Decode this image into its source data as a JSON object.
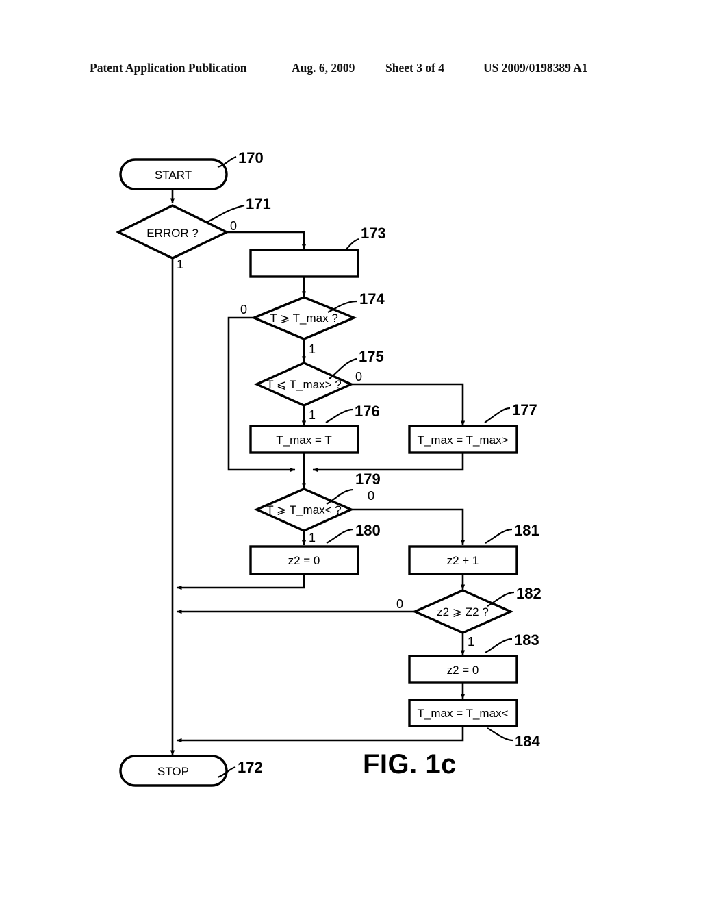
{
  "header": {
    "publication": "Patent Application Publication",
    "date": "Aug. 6, 2009",
    "sheet": "Sheet 3 of 4",
    "patent_number": "US 2009/0198389 A1"
  },
  "figure": {
    "caption": "FIG. 1c",
    "nodes": {
      "start": {
        "ref": "170",
        "text": "START"
      },
      "error": {
        "ref": "171",
        "text": "ERROR ?"
      },
      "stop": {
        "ref": "172",
        "text": "STOP"
      },
      "n173": {
        "ref": "173",
        "text": ""
      },
      "n174": {
        "ref": "174",
        "text": "T ⩾ T_max ?"
      },
      "n175": {
        "ref": "175",
        "text": "T ⩽ T_max> ?"
      },
      "n176": {
        "ref": "176",
        "text": "T_max = T"
      },
      "n177": {
        "ref": "177",
        "text": "T_max = T_max>"
      },
      "n179": {
        "ref": "179",
        "text": "T ⩾ T_max< ?"
      },
      "n180": {
        "ref": "180",
        "text": "z2 = 0"
      },
      "n181": {
        "ref": "181",
        "text": "z2 + 1"
      },
      "n182": {
        "ref": "182",
        "text": "z2 ⩾ Z2 ?"
      },
      "n183": {
        "ref": "183",
        "text": "z2 = 0"
      },
      "n184": {
        "ref": "184",
        "text": "T_max = T_max<"
      }
    },
    "branch_labels": {
      "error_0": "0",
      "error_1": "1",
      "n174_0": "0",
      "n174_1": "1",
      "n175_0": "0",
      "n175_1": "1",
      "n179_0": "0",
      "n179_1": "1",
      "n182_0": "0",
      "n182_1": "1"
    },
    "colors": {
      "stroke": "#000000",
      "fill": "#ffffff",
      "background": "#ffffff"
    }
  }
}
